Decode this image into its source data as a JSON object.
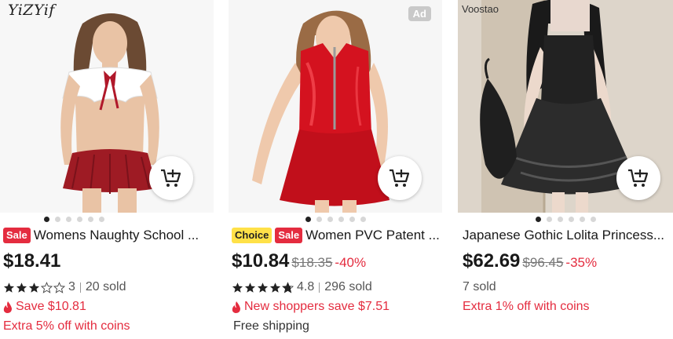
{
  "products": [
    {
      "brand": "YiZYif",
      "ad": "",
      "tags": [
        "Sale"
      ],
      "title": "Womens Naughty School ...",
      "price": "$18.41",
      "original_price": "",
      "discount": "",
      "rating": "3",
      "rating_value": 3,
      "sold": "20 sold",
      "promo": "Save $10.81",
      "extra": "Extra 5% off with coins",
      "shipping": "",
      "active_dot": 0,
      "dots": 6
    },
    {
      "brand": "",
      "ad": "Ad",
      "tags": [
        "Choice",
        "Sale"
      ],
      "title": "Women PVC Patent ...",
      "price": "$10.84",
      "original_price": "$18.35",
      "discount": "-40%",
      "rating": "4.8",
      "rating_value": 4.8,
      "sold": "296 sold",
      "promo": "New shoppers save $7.51",
      "extra": "",
      "shipping": "Free shipping",
      "active_dot": 0,
      "dots": 6
    },
    {
      "brand": "Voostao",
      "ad": "",
      "tags": [],
      "title": "Japanese Gothic Lolita Princess...",
      "price": "$62.69",
      "original_price": "$96.45",
      "discount": "-35%",
      "rating": "",
      "sold": "7 sold",
      "promo": "",
      "extra": "Extra 1% off with coins",
      "shipping": "",
      "active_dot": 0,
      "dots": 6
    }
  ],
  "colors": {
    "accent_red": "#e42c3f",
    "choice_yellow": "#ffe148",
    "text": "#191919"
  },
  "icons": [
    "cart-plus-icon",
    "star-icon",
    "flame-icon"
  ]
}
